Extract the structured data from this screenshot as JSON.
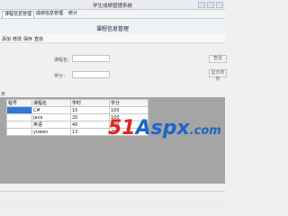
{
  "window": {
    "title": "学生成绩管理系统"
  },
  "tabs": [
    {
      "label": "课程信息管理"
    },
    {
      "label": "成绩信息管理"
    },
    {
      "label": "统计"
    }
  ],
  "header": {
    "title": "课程信息管理"
  },
  "toolbar": {
    "items": [
      "添加",
      "修改",
      "保存",
      "查找"
    ]
  },
  "form": {
    "course_name_label": "课程名：",
    "credit_label": "学分：",
    "btn1": "查找",
    "btn2": "显示所有"
  },
  "section_label": "示",
  "table": {
    "columns": [
      "程号",
      "课程名",
      "学时",
      "学分"
    ],
    "rows": [
      [
        "",
        "C#",
        "10",
        "100"
      ],
      [
        "",
        "java",
        "20",
        "100"
      ],
      [
        "",
        "英语",
        "40",
        "200"
      ],
      [
        "",
        "yuwen",
        "13",
        "45"
      ]
    ]
  },
  "watermark": {
    "part1": "51",
    "part2": "Aspx",
    "part3": ".com",
    "color_red": "#e0251b",
    "color_blue": "#1d66c6"
  }
}
